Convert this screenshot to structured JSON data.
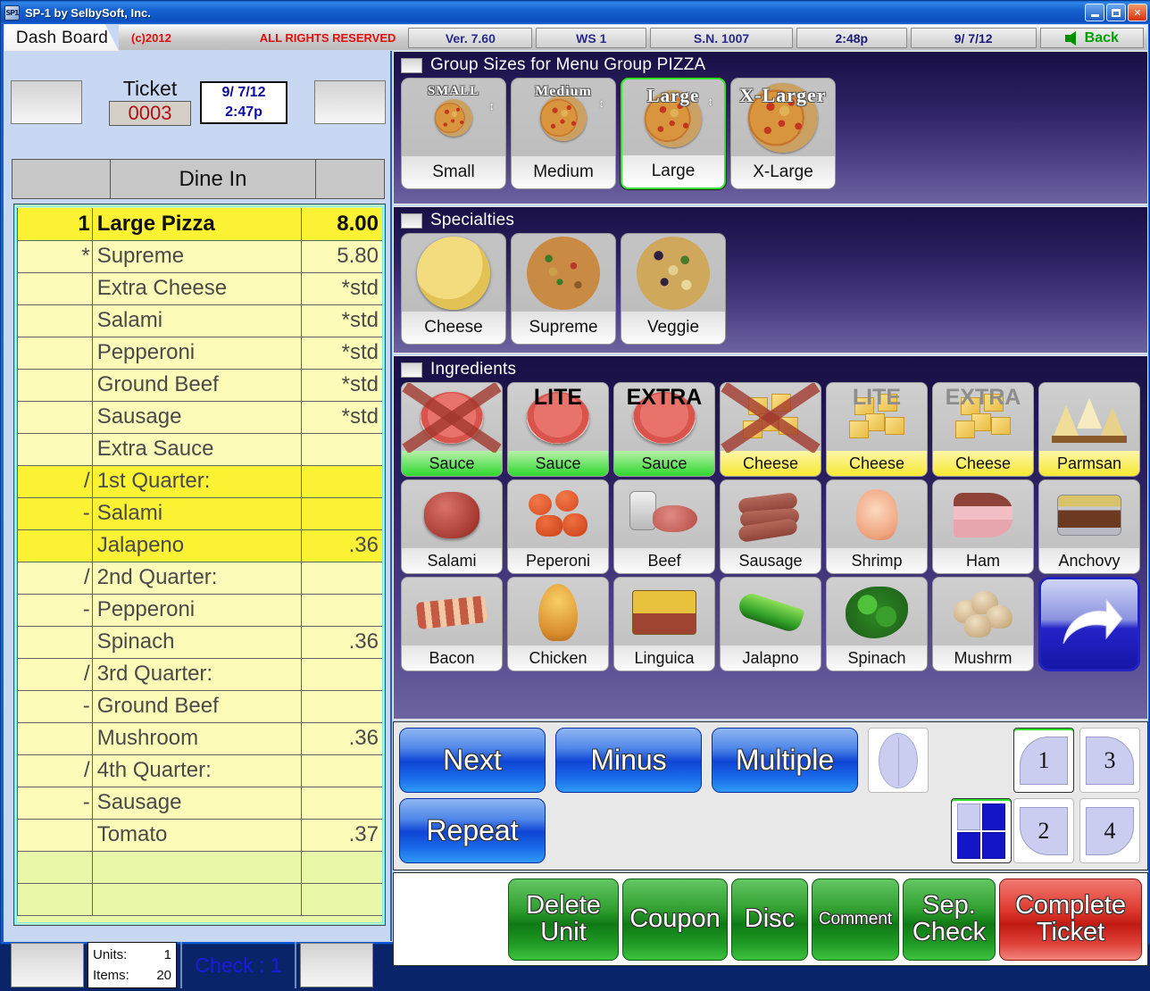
{
  "window": {
    "title": "SP-1 by SelbySoft, Inc.",
    "minimize_label": "Minimize",
    "maximize_label": "Maximize",
    "close_label": "✕"
  },
  "toolbar": {
    "tab_label": "Dash Board",
    "copyright": "(c)2012",
    "rights": "ALL RIGHTS RESERVED",
    "version": "Ver. 7.60",
    "workstation": "WS  1",
    "serial": "S.N. 1007",
    "time": "2:48p",
    "date": "9/ 7/12",
    "back_label": "Back"
  },
  "ticket": {
    "label": "Ticket",
    "number": "0003",
    "date": "9/ 7/12",
    "time": "2:47p",
    "order_type": "Dine In"
  },
  "order_grid": {
    "rows": [
      {
        "qty": "1",
        "desc": "Large Pizza",
        "amt": "8.00",
        "style": "hi-head"
      },
      {
        "qty": "*",
        "desc": "Supreme",
        "amt": "5.80",
        "style": "normal"
      },
      {
        "qty": "",
        "desc": "Extra Cheese",
        "amt": "*std",
        "style": "normal"
      },
      {
        "qty": "",
        "desc": "Salami",
        "amt": "*std",
        "style": "normal"
      },
      {
        "qty": "",
        "desc": "Pepperoni",
        "amt": "*std",
        "style": "normal"
      },
      {
        "qty": "",
        "desc": "Ground Beef",
        "amt": "*std",
        "style": "normal"
      },
      {
        "qty": "",
        "desc": "Sausage",
        "amt": "*std",
        "style": "normal"
      },
      {
        "qty": "",
        "desc": "Extra Sauce",
        "amt": "",
        "style": "normal"
      },
      {
        "qty": "/",
        "desc": "1st Quarter:",
        "amt": "",
        "style": "hi"
      },
      {
        "qty": "-",
        "desc": "Salami",
        "amt": "",
        "style": "hi"
      },
      {
        "qty": "",
        "desc": "Jalapeno",
        "amt": ".36",
        "style": "hi"
      },
      {
        "qty": "/",
        "desc": "2nd Quarter:",
        "amt": "",
        "style": "normal"
      },
      {
        "qty": "-",
        "desc": "Pepperoni",
        "amt": "",
        "style": "normal"
      },
      {
        "qty": "",
        "desc": "Spinach",
        "amt": ".36",
        "style": "normal"
      },
      {
        "qty": "/",
        "desc": "3rd Quarter:",
        "amt": "",
        "style": "normal"
      },
      {
        "qty": "-",
        "desc": "Ground Beef",
        "amt": "",
        "style": "normal"
      },
      {
        "qty": "",
        "desc": "Mushroom",
        "amt": ".36",
        "style": "normal"
      },
      {
        "qty": "/",
        "desc": "4th Quarter:",
        "amt": "",
        "style": "normal"
      },
      {
        "qty": "-",
        "desc": "Sausage",
        "amt": "",
        "style": "normal"
      },
      {
        "qty": "",
        "desc": "Tomato",
        "amt": ".37",
        "style": "normal"
      },
      {
        "qty": "",
        "desc": "",
        "amt": "",
        "style": "empty"
      },
      {
        "qty": "",
        "desc": "",
        "amt": "",
        "style": "empty"
      }
    ]
  },
  "footer": {
    "units_label": "Units:",
    "units_value": "1",
    "items_label": "Items:",
    "items_value": "20",
    "check_label": "Check : 1"
  },
  "sizes": {
    "title": "Group Sizes for Menu Group PIZZA",
    "items": [
      {
        "label": "Small",
        "art_word": "SMALL",
        "selected": false,
        "pie": 42,
        "word_size": 15
      },
      {
        "label": "Medium",
        "art_word": "Medium",
        "selected": false,
        "pie": 52,
        "word_size": 16
      },
      {
        "label": "Large",
        "art_word": "Large",
        "selected": true,
        "pie": 64,
        "word_size": 21
      },
      {
        "label": "X-Large",
        "art_word": "X-Larger",
        "selected": false,
        "pie": 78,
        "word_size": 22
      }
    ]
  },
  "specialties": {
    "title": "Specialties",
    "items": [
      {
        "label": "Cheese",
        "art": "cheesepie"
      },
      {
        "label": "Supreme",
        "art": "supremepie"
      },
      {
        "label": "Veggie",
        "art": "veggiepie"
      }
    ]
  },
  "ingredients": {
    "title": "Ingredients",
    "items": [
      {
        "label": "Sauce",
        "mod": "",
        "cap": "green",
        "art": "sauce",
        "x": true
      },
      {
        "label": "Sauce",
        "mod": "LITE",
        "cap": "green",
        "art": "sauce",
        "x": false
      },
      {
        "label": "Sauce",
        "mod": "EXTRA",
        "cap": "green",
        "art": "sauce",
        "x": false
      },
      {
        "label": "Cheese",
        "mod": "",
        "cap": "yellow",
        "art": "cheese",
        "x": true
      },
      {
        "label": "Cheese",
        "mod": "LITE",
        "cap": "yellow",
        "art": "cheese",
        "x": false,
        "gray": true
      },
      {
        "label": "Cheese",
        "mod": "EXTRA",
        "cap": "yellow",
        "art": "cheese",
        "x": false,
        "gray": true
      },
      {
        "label": "Parmsan",
        "mod": "",
        "cap": "yellow",
        "art": "parmsan",
        "x": false
      },
      {
        "label": "Salami",
        "mod": "",
        "cap": "gray",
        "art": "salami",
        "x": false
      },
      {
        "label": "Peperoni",
        "mod": "",
        "cap": "gray",
        "art": "peperoni",
        "x": false
      },
      {
        "label": "Beef",
        "mod": "",
        "cap": "gray",
        "art": "beef",
        "x": false
      },
      {
        "label": "Sausage",
        "mod": "",
        "cap": "gray",
        "art": "sausage",
        "x": false
      },
      {
        "label": "Shrimp",
        "mod": "",
        "cap": "gray",
        "art": "shrimp",
        "x": false
      },
      {
        "label": "Ham",
        "mod": "",
        "cap": "gray",
        "art": "ham",
        "x": false
      },
      {
        "label": "Anchovy",
        "mod": "",
        "cap": "gray",
        "art": "anchovy",
        "x": false
      },
      {
        "label": "Bacon",
        "mod": "",
        "cap": "gray",
        "art": "bacon",
        "x": false
      },
      {
        "label": "Chicken",
        "mod": "",
        "cap": "gray",
        "art": "chicken",
        "x": false
      },
      {
        "label": "Linguica",
        "mod": "",
        "cap": "gray",
        "art": "linguica",
        "x": false
      },
      {
        "label": "Jalapno",
        "mod": "",
        "cap": "gray",
        "art": "jalapno",
        "x": false
      },
      {
        "label": "Spinach",
        "mod": "",
        "cap": "gray",
        "art": "spinach",
        "x": false
      },
      {
        "label": "Mushrm",
        "mod": "",
        "cap": "gray",
        "art": "mushrm",
        "x": false
      }
    ],
    "back_button": "back-arrow"
  },
  "actions": {
    "next": "Next",
    "minus": "Minus",
    "multiple": "Multiple",
    "repeat": "Repeat",
    "whole_label": "whole",
    "quad_label": "quarters",
    "quarters": [
      {
        "label": "1",
        "selected": true
      },
      {
        "label": "3",
        "selected": false
      },
      {
        "label": "2",
        "selected": false
      },
      {
        "label": "4",
        "selected": false
      }
    ]
  },
  "bottom": {
    "delete_unit": [
      "Delete",
      "Unit"
    ],
    "coupon": [
      "Coupon"
    ],
    "disc": [
      "Disc"
    ],
    "comment": [
      "Comment"
    ],
    "sep_check": [
      "Sep.",
      "Check"
    ],
    "complete_ticket": [
      "Complete",
      "Ticket"
    ]
  }
}
